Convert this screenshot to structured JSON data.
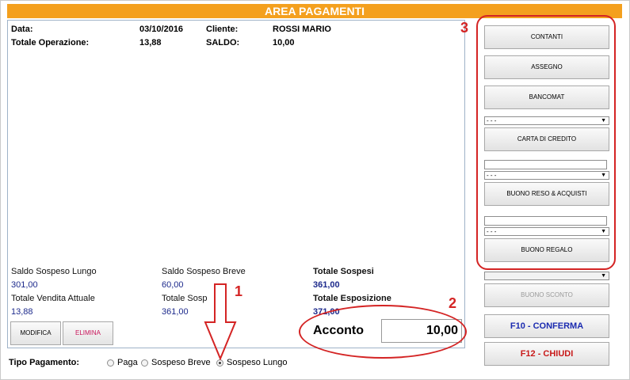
{
  "title": "AREA PAGAMENTI",
  "header": {
    "data_label": "Data:",
    "data_value": "03/10/2016",
    "cliente_label": "Cliente:",
    "cliente_value": "ROSSI MARIO",
    "totale_label": "Totale Operazione:",
    "totale_value": "13,88",
    "saldo_label": "SALDO:",
    "saldo_value": "10,00"
  },
  "stats": {
    "saldo_lungo_label": "Saldo Sospeso Lungo",
    "saldo_lungo_value": "301,00",
    "saldo_breve_label": "Saldo Sospeso Breve",
    "saldo_breve_value": "60,00",
    "totale_sospesi_label": "Totale Sospesi",
    "totale_sospesi_value": "361,00",
    "vendita_label": "Totale Vendita Attuale",
    "vendita_value": "13,88",
    "totale_sosp_label": "Totale Sosp",
    "totale_sosp_value": "361,00",
    "esposizione_label": "Totale Esposizione",
    "esposizione_value": "371,00"
  },
  "buttons": {
    "modifica": "MODIFICA",
    "elimina": "ELIMINA"
  },
  "acconto": {
    "label": "Acconto",
    "value": "10,00"
  },
  "tipo_pagamento": {
    "label": "Tipo Pagamento:",
    "options": [
      "Paga",
      "Sospeso Breve",
      "Sospeso Lungo"
    ],
    "selected": "Sospeso Lungo"
  },
  "side": {
    "contanti": "CONTANTI",
    "assegno": "ASSEGNO",
    "bancomat": "BANCOMAT",
    "select_placeholder": "- - -",
    "carta": "CARTA  DI CREDITO",
    "buono_reso": "BUONO RESO & ACQUISTI",
    "buono_regalo": "BUONO REGALO",
    "buono_sconto": "BUONO SCONTO",
    "conferma": "F10 - CONFERMA",
    "chiudi": "F12 - CHIUDI"
  },
  "annotations": [
    "1",
    "2",
    "3"
  ],
  "colors": {
    "title_bar": "#f4a01e",
    "annotation": "#d42424",
    "value_blue": "#1d2a8c",
    "confirm": "#1b2bb0",
    "close": "#c81a1a"
  }
}
